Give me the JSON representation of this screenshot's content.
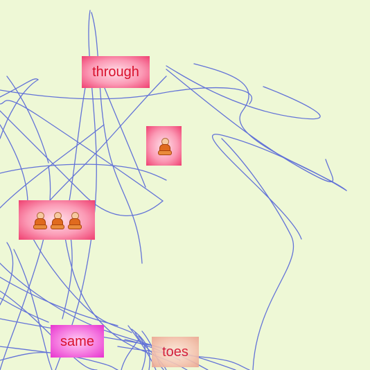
{
  "tiles": {
    "through": {
      "word": "through"
    },
    "same": {
      "word": "same"
    },
    "toes": {
      "word": "toes"
    },
    "single_figure": {
      "icon": "meditating-person-icon",
      "count": 1
    },
    "triple_figure": {
      "icon": "meditating-person-icon",
      "count": 3
    }
  },
  "colors": {
    "background": "#eef8d6",
    "scribble": "#4a5bd8",
    "word_text": "#d8102c"
  }
}
